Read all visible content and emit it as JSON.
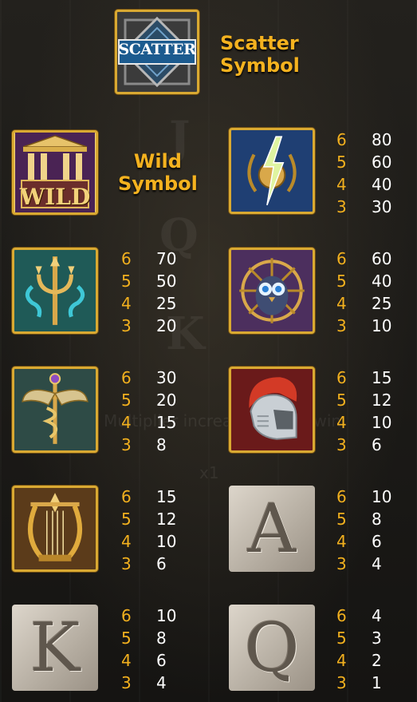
{
  "scatter": {
    "badge": "SCATTER",
    "label_line1": "Scatter",
    "label_line2": "Symbol"
  },
  "wild": {
    "badge": "WILD",
    "label_line1": "Wild",
    "label_line2": "Symbol"
  },
  "symbols": {
    "lightning": {
      "icon": "lightning-laurel-icon",
      "pays": [
        [
          "6",
          "80"
        ],
        [
          "5",
          "60"
        ],
        [
          "4",
          "40"
        ],
        [
          "3",
          "30"
        ]
      ]
    },
    "trident": {
      "icon": "trident-icon",
      "pays": [
        [
          "6",
          "70"
        ],
        [
          "5",
          "50"
        ],
        [
          "4",
          "25"
        ],
        [
          "3",
          "20"
        ]
      ]
    },
    "owl": {
      "icon": "owl-icon",
      "pays": [
        [
          "6",
          "60"
        ],
        [
          "5",
          "40"
        ],
        [
          "4",
          "25"
        ],
        [
          "3",
          "10"
        ]
      ]
    },
    "caduceus": {
      "icon": "caduceus-icon",
      "pays": [
        [
          "6",
          "30"
        ],
        [
          "5",
          "20"
        ],
        [
          "4",
          "15"
        ],
        [
          "3",
          "8"
        ]
      ]
    },
    "helmet": {
      "icon": "spartan-helmet-icon",
      "pays": [
        [
          "6",
          "15"
        ],
        [
          "5",
          "12"
        ],
        [
          "4",
          "10"
        ],
        [
          "3",
          "6"
        ]
      ]
    },
    "lyre": {
      "icon": "lyre-icon",
      "pays": [
        [
          "6",
          "15"
        ],
        [
          "5",
          "12"
        ],
        [
          "4",
          "10"
        ],
        [
          "3",
          "6"
        ]
      ]
    },
    "a": {
      "letter": "A",
      "pays": [
        [
          "6",
          "10"
        ],
        [
          "5",
          "8"
        ],
        [
          "4",
          "6"
        ],
        [
          "3",
          "4"
        ]
      ]
    },
    "k": {
      "letter": "K",
      "pays": [
        [
          "6",
          "10"
        ],
        [
          "5",
          "8"
        ],
        [
          "4",
          "6"
        ],
        [
          "3",
          "4"
        ]
      ]
    },
    "q": {
      "letter": "Q",
      "pays": [
        [
          "6",
          "4"
        ],
        [
          "5",
          "3"
        ],
        [
          "4",
          "2"
        ],
        [
          "3",
          "1"
        ]
      ]
    }
  },
  "colors": {
    "gold_text": "#f2b01e",
    "frame_gold": "#d9a932",
    "background": "#1b1a18"
  }
}
